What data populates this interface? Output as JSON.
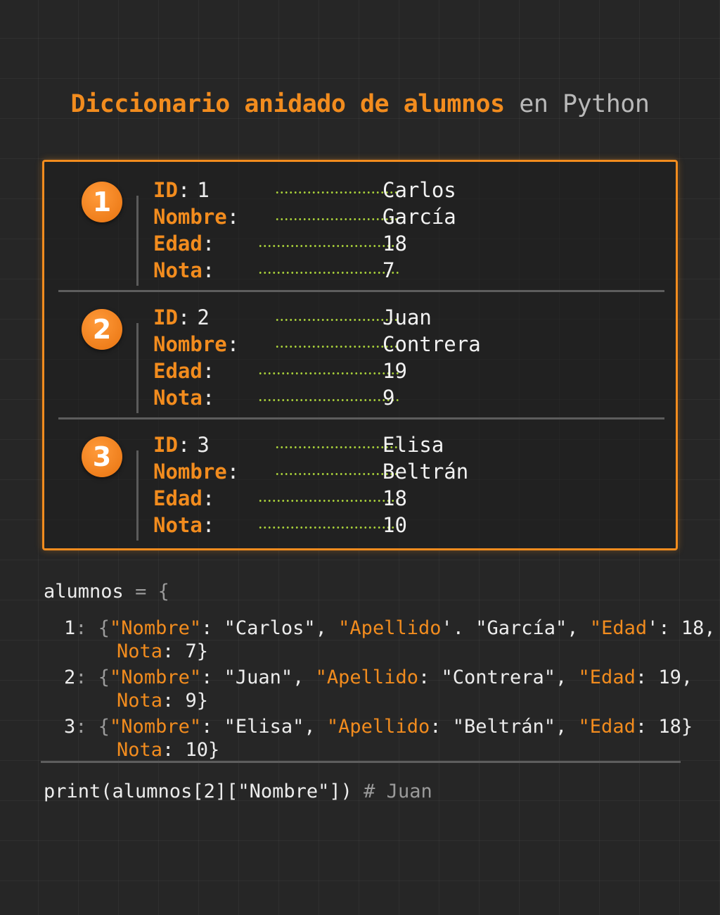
{
  "title": {
    "highlight": "Diccionario anidado de alumnos",
    "rest": "en Python"
  },
  "records": [
    {
      "number": "1",
      "id": "1",
      "nombre": "Carlos",
      "apellido": "García",
      "edad": "18",
      "nota": "7"
    },
    {
      "number": "2",
      "id": "2",
      "nombre": "Juan",
      "apellido": "Contrera",
      "edad": "19",
      "nota": "9"
    },
    {
      "number": "3",
      "id": "3",
      "nombre": "Elisa",
      "apellido": "Beltrán",
      "edad": "18",
      "nota": "10"
    }
  ],
  "labels": {
    "id": "ID",
    "nombre": "Nombre",
    "edad": "Edad",
    "nota": "Nota",
    "colon": ":"
  },
  "code": {
    "header": {
      "var": "alumnos",
      "eq": "=",
      "brace": "{"
    },
    "entries": [
      {
        "line1": [
          {
            "t": "1",
            "s": ""
          },
          {
            "t": ": {",
            "s": "dim"
          },
          {
            "t": "\"Nombre\"",
            "s": "ok"
          },
          {
            "t": ": \"Carlos\", ",
            "s": ""
          },
          {
            "t": "\"Apellido",
            "s": "ok"
          },
          {
            "t": "'. \"García\", ",
            "s": ""
          },
          {
            "t": "\"Edad",
            "s": "ok"
          },
          {
            "t": "': 18,",
            "s": ""
          }
        ],
        "line2": [
          {
            "t": "Nota",
            "s": "ok"
          },
          {
            "t": ": 7}",
            "s": ""
          }
        ]
      },
      {
        "line1": [
          {
            "t": "2",
            "s": ""
          },
          {
            "t": ": {",
            "s": "dim"
          },
          {
            "t": "\"Nombre\"",
            "s": "ok"
          },
          {
            "t": ": \"Juan\", ",
            "s": ""
          },
          {
            "t": "\"Apellido",
            "s": "ok"
          },
          {
            "t": ": \"Contrera\", ",
            "s": ""
          },
          {
            "t": "\"Edad",
            "s": "ok"
          },
          {
            "t": ": 19,",
            "s": ""
          }
        ],
        "line2": [
          {
            "t": "Nota",
            "s": "ok"
          },
          {
            "t": ": 9}",
            "s": ""
          }
        ]
      },
      {
        "line1": [
          {
            "t": "3",
            "s": ""
          },
          {
            "t": ": {",
            "s": "dim"
          },
          {
            "t": "\"Nombre\"",
            "s": "ok"
          },
          {
            "t": ": \"Elisa\", ",
            "s": ""
          },
          {
            "t": "\"Apellido",
            "s": "ok"
          },
          {
            "t": ": \"Beltrán\", ",
            "s": ""
          },
          {
            "t": "\"Edad",
            "s": "ok"
          },
          {
            "t": ": 18}",
            "s": ""
          }
        ],
        "line2": [
          {
            "t": "Nota",
            "s": "ok"
          },
          {
            "t": ": 10}",
            "s": ""
          }
        ]
      }
    ],
    "print_stmt": "print(alumnos[2][\"Nombre\"])",
    "print_comment": "# Juan"
  },
  "colors": {
    "accent": "#f28c1e",
    "dots": "#a9d13a",
    "background": "#262626"
  }
}
